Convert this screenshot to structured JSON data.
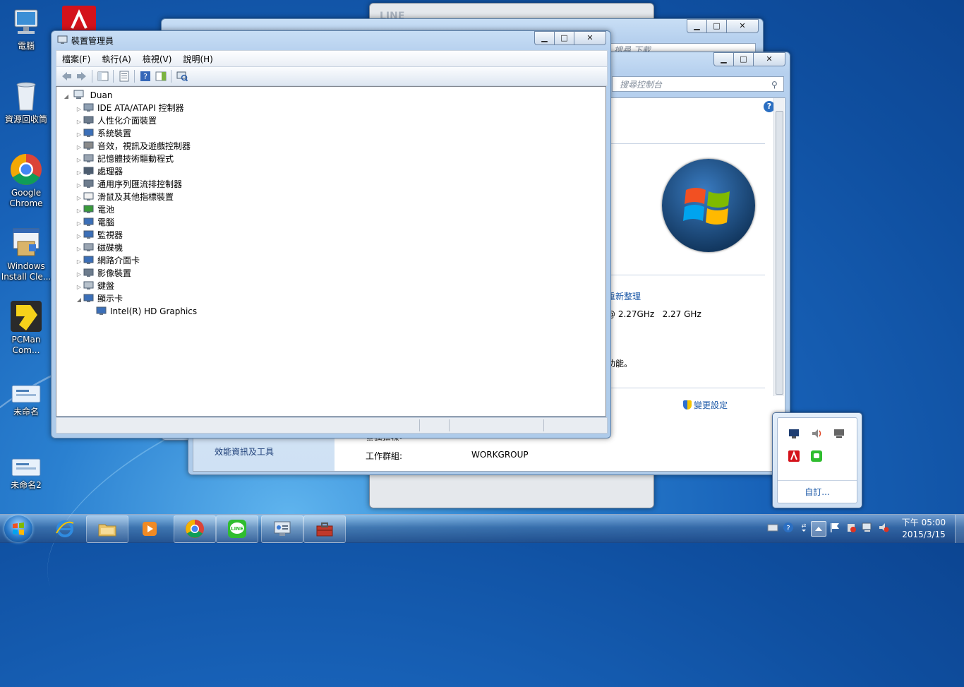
{
  "desktop": {
    "icons": [
      {
        "label": "電腦"
      },
      {
        "label": "資源回收筒"
      },
      {
        "label": "Google Chrome"
      },
      {
        "label": "Windows Install Cle..."
      },
      {
        "label": "PCMan Com..."
      },
      {
        "label": "未命名"
      },
      {
        "label": "未命名2"
      }
    ]
  },
  "line_window": {
    "title": "LINE"
  },
  "back_window": {
    "search_placeholder": "搜尋 下載"
  },
  "system_window": {
    "search_placeholder": "搜尋控制台",
    "left_link": "效能資訊及工具",
    "rows": {
      "reorg_link": "重新整理",
      "processor_value": "@ 2.27GHz   2.27 GHz",
      "feature_text": "功能。",
      "change_settings": "變更設定",
      "computer_desc_label": "電腦描述:",
      "workgroup_label": "工作群組:",
      "workgroup_value": "WORKGROUP"
    }
  },
  "device_manager": {
    "title": "裝置管理員",
    "menu": [
      "檔案(F)",
      "執行(A)",
      "檢視(V)",
      "說明(H)"
    ],
    "root": "Duan",
    "nodes": [
      "IDE ATA/ATAPI 控制器",
      "人性化介面裝置",
      "系統裝置",
      "音效，視訊及遊戲控制器",
      "記憶體技術驅動程式",
      "處理器",
      "通用序列匯流排控制器",
      "滑鼠及其他指標裝置",
      "電池",
      "電腦",
      "監視器",
      "磁碟機",
      "網路介面卡",
      "影像裝置",
      "鍵盤",
      "顯示卡"
    ],
    "child": "Intel(R) HD Graphics"
  },
  "tray_popup": {
    "customize": "自訂..."
  },
  "taskbar": {
    "clock_time": "下午 05:00",
    "clock_date": "2015/3/15"
  }
}
